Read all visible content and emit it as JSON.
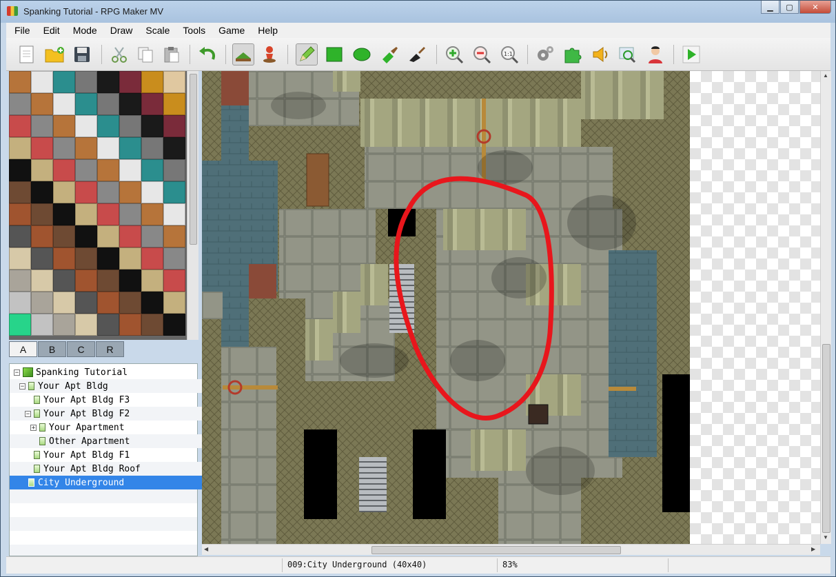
{
  "window": {
    "title": "Spanking Tutorial - RPG Maker MV",
    "minimize": "▁",
    "maximize": "▢",
    "close": "✕"
  },
  "menu": [
    "File",
    "Edit",
    "Mode",
    "Draw",
    "Scale",
    "Tools",
    "Game",
    "Help"
  ],
  "toolbar": {
    "buttons": [
      {
        "name": "new-project-icon"
      },
      {
        "name": "open-project-icon"
      },
      {
        "name": "save-project-icon"
      },
      {
        "name": "cut-icon"
      },
      {
        "name": "copy-icon"
      },
      {
        "name": "paste-icon"
      },
      {
        "name": "undo-icon"
      },
      {
        "name": "map-mode-icon",
        "pressed": true
      },
      {
        "name": "event-mode-icon"
      },
      {
        "name": "pencil-icon",
        "pressed": true
      },
      {
        "name": "rectangle-icon"
      },
      {
        "name": "ellipse-icon"
      },
      {
        "name": "flood-fill-icon"
      },
      {
        "name": "shadow-pen-icon"
      },
      {
        "name": "zoom-in-icon"
      },
      {
        "name": "zoom-out-icon"
      },
      {
        "name": "zoom-actual-icon"
      },
      {
        "name": "database-icon"
      },
      {
        "name": "plugin-manager-icon"
      },
      {
        "name": "sound-test-icon"
      },
      {
        "name": "event-search-icon"
      },
      {
        "name": "character-generator-icon"
      },
      {
        "name": "playtest-icon"
      }
    ]
  },
  "tileset_tabs": [
    "A",
    "B",
    "C",
    "R"
  ],
  "map_tree": {
    "project": "Spanking Tutorial",
    "items": [
      {
        "label": "Your Apt Bldg",
        "level": 1,
        "expander": "−"
      },
      {
        "label": "Your Apt Bldg F3",
        "level": 2,
        "expander": ""
      },
      {
        "label": "Your Apt Bldg F2",
        "level": 2,
        "expander": "−"
      },
      {
        "label": "Your Apartment",
        "level": 3,
        "expander": "+"
      },
      {
        "label": "Other Apartment",
        "level": 3,
        "expander": ""
      },
      {
        "label": "Your Apt Bldg F1",
        "level": 2,
        "expander": ""
      },
      {
        "label": "Your Apt Bldg Roof",
        "level": 2,
        "expander": ""
      },
      {
        "label": "City Underground",
        "level": 1,
        "expander": "",
        "selected": true
      }
    ]
  },
  "status": {
    "map_info": "009:City Underground (40x40)",
    "zoom": "83%"
  },
  "colors": {
    "highlight_circle": "#e8161c",
    "selection": "#3385e8"
  }
}
